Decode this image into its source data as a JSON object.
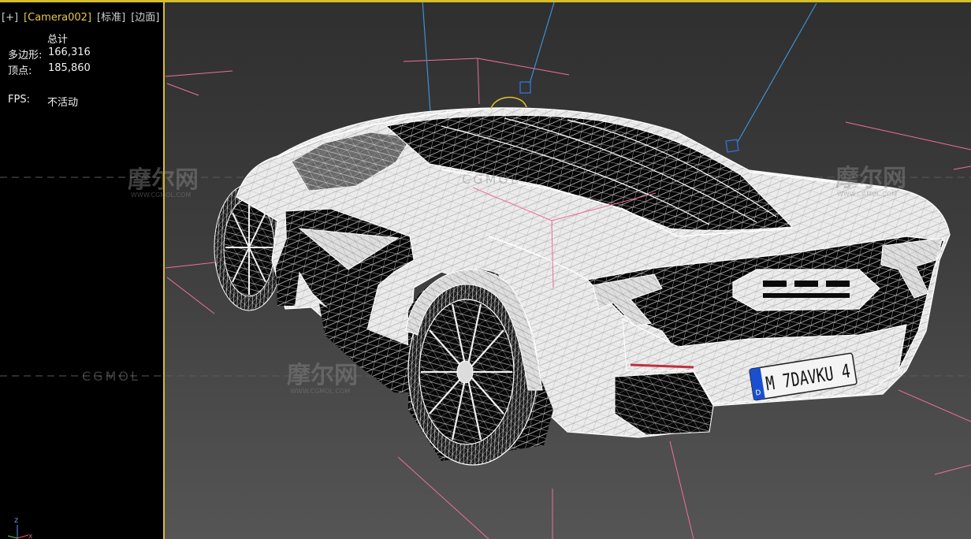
{
  "viewport": {
    "menu": {
      "plus": "[+]",
      "camera": "[Camera002]",
      "shading": "[标准]",
      "edges": "[边面]"
    }
  },
  "stats": {
    "header": "总计",
    "polygons": {
      "label": "多边形:",
      "value": "166,316"
    },
    "vertices": {
      "label": "顶点:",
      "value": "185,860"
    },
    "fps": {
      "label": "FPS:",
      "value": "不活动"
    }
  },
  "license_plate": {
    "country": "D",
    "text": "M 7DAVKU 4"
  },
  "axis_gizmo": {
    "z": "z",
    "x": "x"
  },
  "watermark": {
    "logo": "摩尔网",
    "url": "WWW.CGMOL.COM",
    "brand": "CGMOL"
  },
  "colors": {
    "active_border": "#d6bf2a",
    "camera_label": "#e6c84b",
    "helper_lines": "#ee6f9b",
    "light_lines": "#3d8fd6",
    "wireframe": "#ffffff"
  }
}
